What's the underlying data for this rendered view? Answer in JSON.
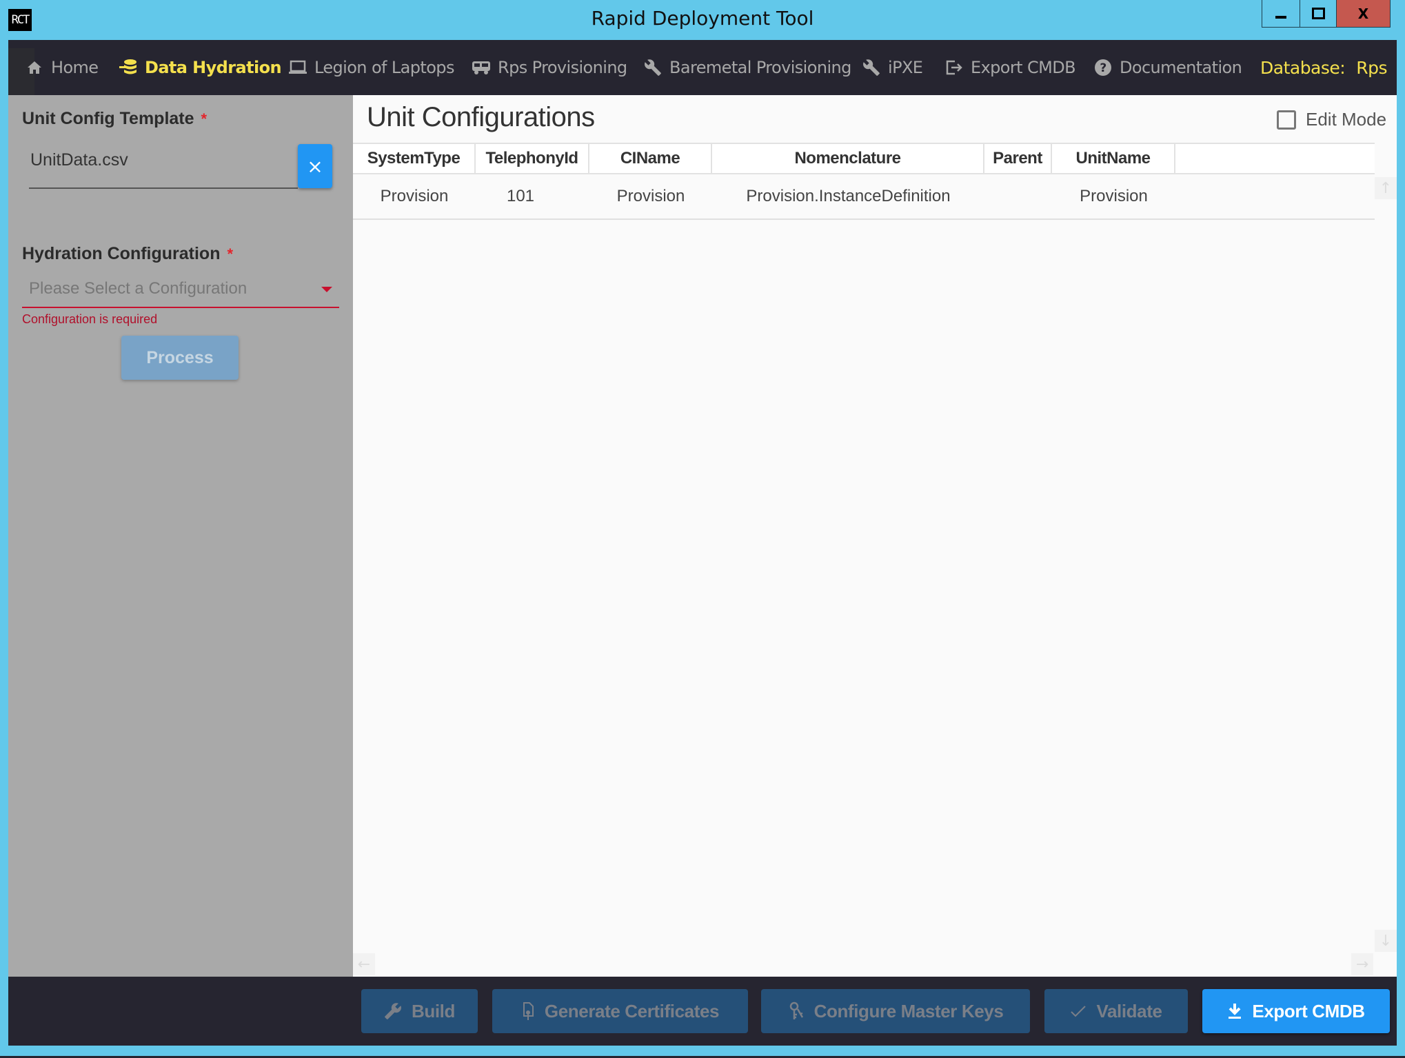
{
  "window": {
    "logo_text": "RCT",
    "title": "Rapid Deployment Tool",
    "controls": {
      "minimize": "minimize",
      "maximize": "maximize",
      "close": "X"
    }
  },
  "nav": {
    "items": [
      {
        "label": "Home",
        "icon": "home-icon",
        "active": false
      },
      {
        "label": "Data Hydration",
        "icon": "database-import-icon",
        "active": true
      },
      {
        "label": "Legion of Laptops",
        "icon": "laptop-icon",
        "active": false
      },
      {
        "label": "Rps Provisioning",
        "icon": "truck-icon",
        "active": false
      },
      {
        "label": "Baremetal Provisioning",
        "icon": "wrench-icon",
        "active": false
      },
      {
        "label": "iPXE",
        "icon": "wrench-icon",
        "active": false
      },
      {
        "label": "Export CMDB",
        "icon": "export-icon",
        "active": false
      },
      {
        "label": "Documentation",
        "icon": "help-circle-icon",
        "active": false
      }
    ],
    "database_label": "Database:",
    "database_value": "Rps",
    "colors": {
      "active": "#f4e04d",
      "inactive": "#a8a8a8",
      "background": "#262530"
    }
  },
  "sidebar": {
    "unit_config_template": {
      "label": "Unit Config Template",
      "required_marker": "*",
      "value": "UnitData.csv",
      "clear_icon": "×"
    },
    "hydration_configuration": {
      "label": "Hydration Configuration",
      "required_marker": "*",
      "placeholder": "Please Select a Configuration",
      "error": "Configuration is required"
    },
    "process_button": "Process"
  },
  "main": {
    "title": "Unit Configurations",
    "edit_mode": {
      "label": "Edit Mode",
      "checked": false
    },
    "table": {
      "columns": [
        "SystemType",
        "TelephonyId",
        "CIName",
        "Nomenclature",
        "Parent",
        "UnitName"
      ],
      "rows": [
        [
          "Provision",
          "101",
          "Provision",
          "Provision.InstanceDefinition",
          "",
          "Provision"
        ]
      ]
    },
    "scroll_glyphs": {
      "up": "↑",
      "down": "↓",
      "left": "←",
      "right": "→"
    }
  },
  "actions": {
    "build": {
      "label": "Build",
      "icon": "wrench-icon",
      "enabled": false
    },
    "generate_certificates": {
      "label": "Generate Certificates",
      "icon": "certificate-icon",
      "enabled": false
    },
    "configure_master_keys": {
      "label": "Configure Master Keys",
      "icon": "keys-icon",
      "enabled": false
    },
    "validate": {
      "label": "Validate",
      "icon": "check-icon",
      "enabled": false
    },
    "export_cmdb": {
      "label": "Export CMDB",
      "icon": "download-icon",
      "enabled": true
    }
  }
}
